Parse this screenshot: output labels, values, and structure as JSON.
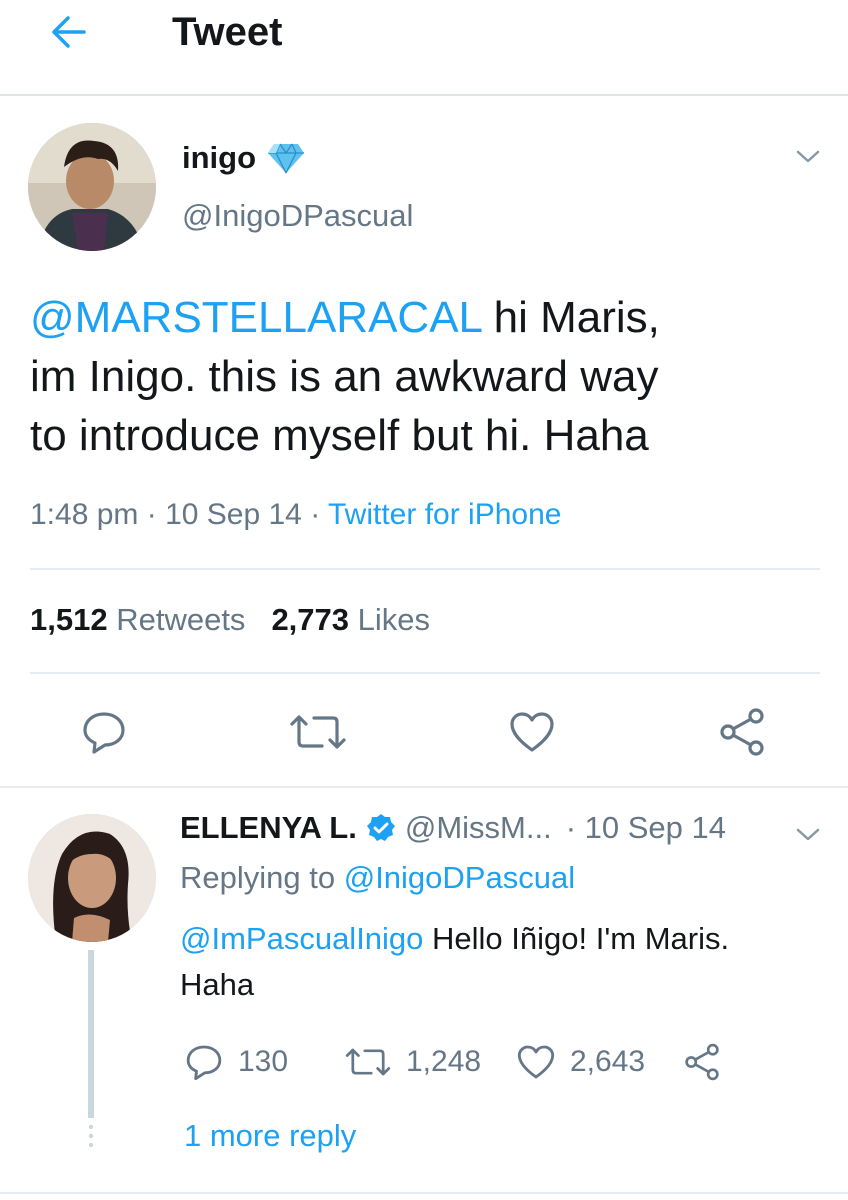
{
  "header": {
    "title": "Tweet",
    "back_icon": "arrow-left-icon"
  },
  "colors": {
    "accent": "#1da1f2",
    "secondary_text": "#657786",
    "primary_text": "#14171a",
    "divider": "#e6ecf0"
  },
  "tweet": {
    "display_name": "inigo",
    "handle": "@InigoDPascual",
    "mention": "@MARSTELLARACAL",
    "text_line1": " hi Maris,",
    "text_line2": "im Inigo. this is an awkward way",
    "text_line3": "to introduce myself but hi. Haha",
    "time": "1:48 pm",
    "date": "10 Sep 14",
    "source": "Twitter for iPhone",
    "retweets_count": "1,512",
    "retweets_label": "Retweets",
    "likes_count": "2,773",
    "likes_label": "Likes"
  },
  "reply": {
    "display_name": "ELLENYA L.",
    "handle": "@MissM...",
    "date": "10 Sep 14",
    "replying_prefix": "Replying to ",
    "replying_handle": "@InigoDPascual",
    "mention": "@ImPascualInigo",
    "text_part1": " Hello Iñigo! I'm Maris.",
    "text_line2": "Haha",
    "reply_count": "130",
    "retweet_count": "1,248",
    "like_count": "2,643",
    "more_replies": "1 more reply"
  }
}
